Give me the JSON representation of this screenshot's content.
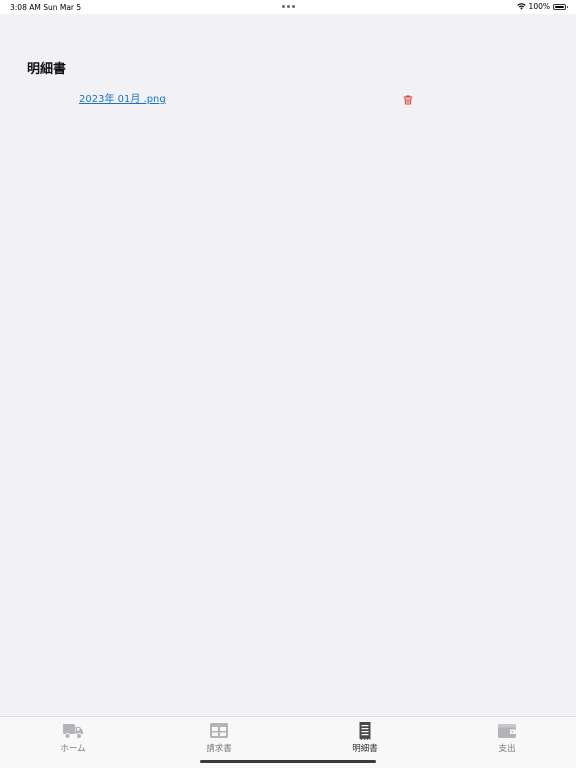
{
  "status_bar": {
    "time_date": "3:08 AM   Sun Mar 5",
    "battery_text": "100%",
    "battery_level": 1.0,
    "wifi_icon": "wifi-icon",
    "battery_icon": "battery-icon"
  },
  "page": {
    "title": "明細書"
  },
  "files": [
    {
      "name": "2023年 01月 .png",
      "delete_icon": "trash-icon",
      "delete_color": "#e0463f"
    }
  ],
  "tabs": [
    {
      "label": "ホーム",
      "icon": "truck-icon",
      "active": false
    },
    {
      "label": "請求書",
      "icon": "table-icon",
      "active": false
    },
    {
      "label": "明細書",
      "icon": "receipt-icon",
      "active": true
    },
    {
      "label": "支出",
      "icon": "wallet-icon",
      "active": false
    }
  ],
  "colors": {
    "link": "#1a73c9",
    "tab_inactive": "#a9a9ad",
    "tab_active": "#4a4a4e",
    "background": "#f2f1f6"
  }
}
